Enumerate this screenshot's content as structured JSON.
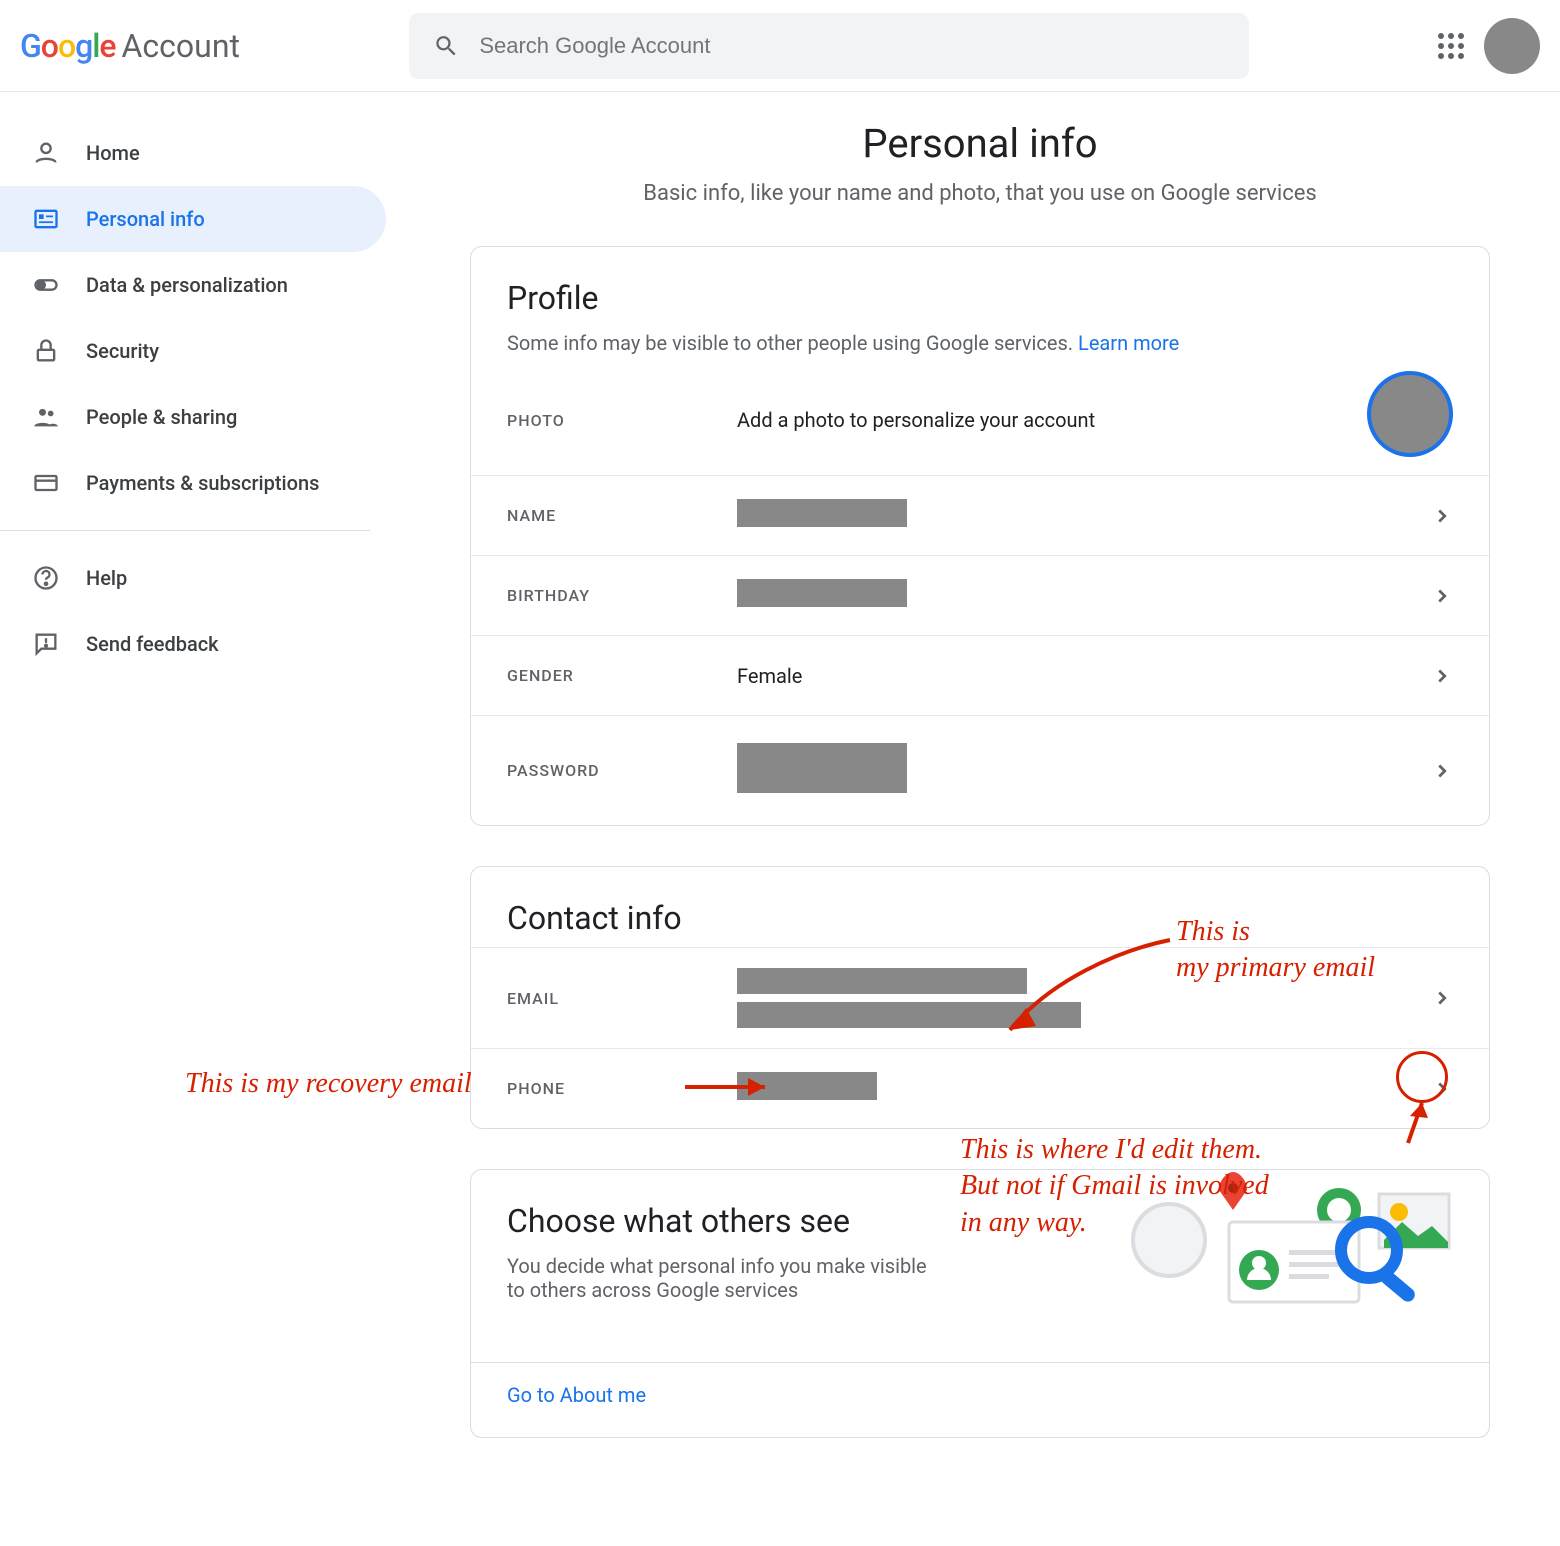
{
  "header": {
    "logo_text": "Google",
    "logo_account": "Account",
    "search_placeholder": "Search Google Account"
  },
  "nav": {
    "home": "Home",
    "personal": "Personal info",
    "data": "Data & personalization",
    "security": "Security",
    "people": "People & sharing",
    "payments": "Payments & subscriptions",
    "help": "Help",
    "feedback": "Send feedback"
  },
  "page": {
    "title": "Personal info",
    "subtitle": "Basic info, like your name and photo, that you use on Google services"
  },
  "profile": {
    "title": "Profile",
    "subtitle": "Some info may be visible to other people using Google services. ",
    "learn_more": "Learn more",
    "rows": {
      "photo_label": "PHOTO",
      "photo_value": "Add a photo to personalize your account",
      "name_label": "NAME",
      "birthday_label": "BIRTHDAY",
      "gender_label": "GENDER",
      "gender_value": "Female",
      "password_label": "PASSWORD"
    }
  },
  "contact": {
    "title": "Contact info",
    "email_label": "EMAIL",
    "phone_label": "PHONE"
  },
  "choose": {
    "title": "Choose what others see",
    "subtitle": "You decide what personal info you make visible to others across Google services",
    "link": "Go to About me"
  },
  "annotations": {
    "primary": "This is\nmy primary email",
    "recovery": "This is my recovery email",
    "edit": "This is where I'd edit them.\nBut not if Gmail is involved\nin any way."
  }
}
